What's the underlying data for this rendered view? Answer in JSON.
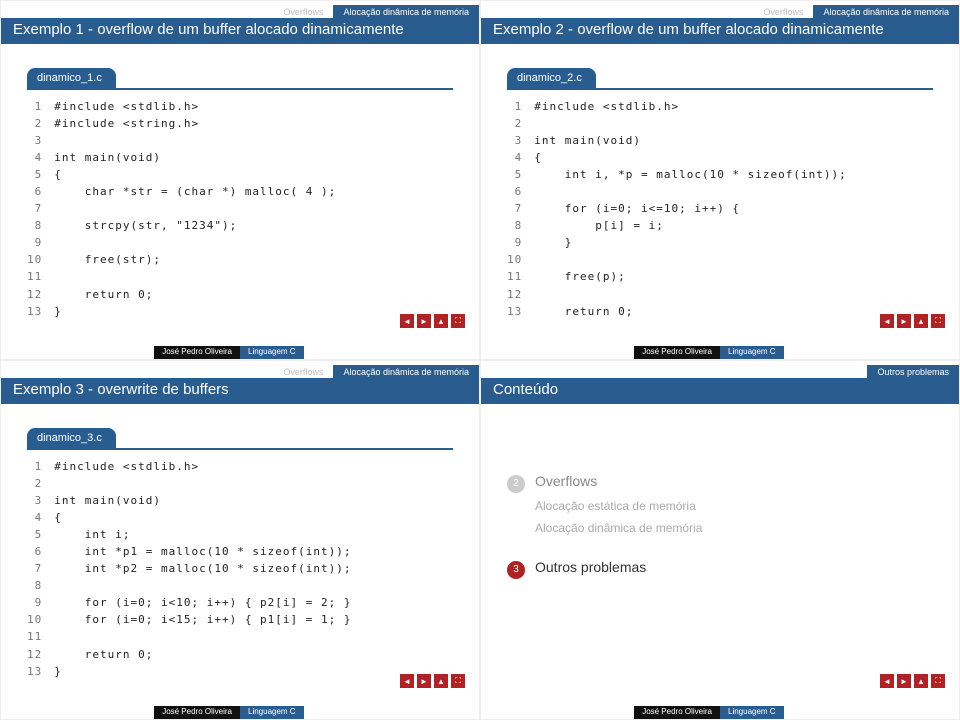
{
  "tabs": {
    "overflow": "Overflows",
    "alloc": "Alocação dinâmica de memória",
    "outros": "Outros problemas"
  },
  "slide1": {
    "title": "Exemplo 1 - overflow de um buffer alocado dinamicamente",
    "file": "dinamico_1.c",
    "linenos": " 1\n 2\n 3\n 4\n 5\n 6\n 7\n 8\n 9\n10\n11\n12\n13",
    "code": "#include <stdlib.h>\n#include <string.h>\n\nint main(void)\n{\n    char *str = (char *) malloc( 4 );\n\n    strcpy(str, \"1234\");\n\n    free(str);\n\n    return 0;\n}"
  },
  "slide2": {
    "title": "Exemplo 2 - overflow de um buffer alocado dinamicamente",
    "file": "dinamico_2.c",
    "linenos": " 1\n 2\n 3\n 4\n 5\n 6\n 7\n 8\n 9\n10\n11\n12\n13",
    "code": "#include <stdlib.h>\n\nint main(void)\n{\n    int i, *p = malloc(10 * sizeof(int));\n\n    for (i=0; i<=10; i++) {\n        p[i] = i;\n    }\n\n    free(p);\n\n    return 0;"
  },
  "slide3": {
    "title": "Exemplo 3 - overwrite de buffers",
    "file": "dinamico_3.c",
    "linenos": " 1\n 2\n 3\n 4\n 5\n 6\n 7\n 8\n 9\n10\n11\n12\n13",
    "code": "#include <stdlib.h>\n\nint main(void)\n{\n    int i;\n    int *p1 = malloc(10 * sizeof(int));\n    int *p2 = malloc(10 * sizeof(int));\n\n    for (i=0; i<10; i++) { p2[i] = 2; }\n    for (i=0; i<15; i++) { p1[i] = 1; }\n\n    return 0;\n}"
  },
  "slide4": {
    "title": "Conteúdo",
    "toc": {
      "item2_num": "2",
      "item2_label": "Overflows",
      "item2_sub1": "Alocação estática de memória",
      "item2_sub2": "Alocação dinâmica de memória",
      "item3_num": "3",
      "item3_label": "Outros problemas"
    }
  },
  "footer": {
    "author": "José Pedro Oliveira",
    "course": "Linguagem C"
  },
  "nav": {
    "back": "◄",
    "fwd": "►",
    "up": "▲",
    "full": "⛶"
  }
}
